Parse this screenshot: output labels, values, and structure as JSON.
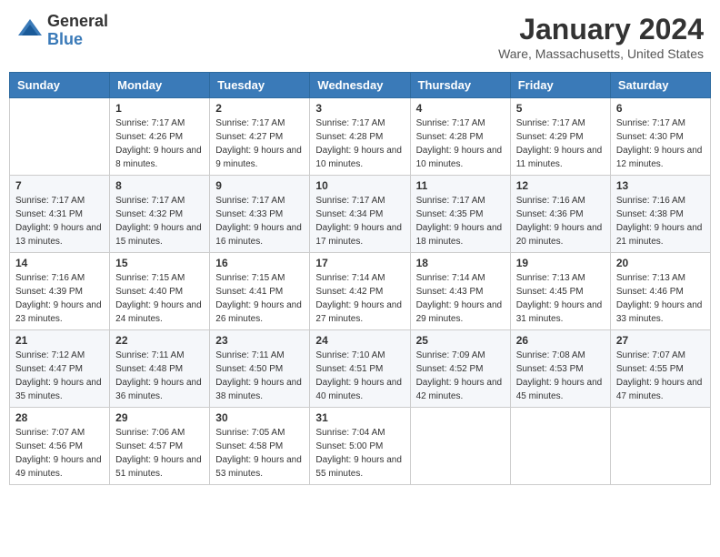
{
  "header": {
    "logo_general": "General",
    "logo_blue": "Blue",
    "title": "January 2024",
    "location": "Ware, Massachusetts, United States"
  },
  "days_of_week": [
    "Sunday",
    "Monday",
    "Tuesday",
    "Wednesday",
    "Thursday",
    "Friday",
    "Saturday"
  ],
  "weeks": [
    [
      {
        "day": "",
        "sunrise": "",
        "sunset": "",
        "daylight": ""
      },
      {
        "day": "1",
        "sunrise": "Sunrise: 7:17 AM",
        "sunset": "Sunset: 4:26 PM",
        "daylight": "Daylight: 9 hours and 8 minutes."
      },
      {
        "day": "2",
        "sunrise": "Sunrise: 7:17 AM",
        "sunset": "Sunset: 4:27 PM",
        "daylight": "Daylight: 9 hours and 9 minutes."
      },
      {
        "day": "3",
        "sunrise": "Sunrise: 7:17 AM",
        "sunset": "Sunset: 4:28 PM",
        "daylight": "Daylight: 9 hours and 10 minutes."
      },
      {
        "day": "4",
        "sunrise": "Sunrise: 7:17 AM",
        "sunset": "Sunset: 4:28 PM",
        "daylight": "Daylight: 9 hours and 10 minutes."
      },
      {
        "day": "5",
        "sunrise": "Sunrise: 7:17 AM",
        "sunset": "Sunset: 4:29 PM",
        "daylight": "Daylight: 9 hours and 11 minutes."
      },
      {
        "day": "6",
        "sunrise": "Sunrise: 7:17 AM",
        "sunset": "Sunset: 4:30 PM",
        "daylight": "Daylight: 9 hours and 12 minutes."
      }
    ],
    [
      {
        "day": "7",
        "sunrise": "Sunrise: 7:17 AM",
        "sunset": "Sunset: 4:31 PM",
        "daylight": "Daylight: 9 hours and 13 minutes."
      },
      {
        "day": "8",
        "sunrise": "Sunrise: 7:17 AM",
        "sunset": "Sunset: 4:32 PM",
        "daylight": "Daylight: 9 hours and 15 minutes."
      },
      {
        "day": "9",
        "sunrise": "Sunrise: 7:17 AM",
        "sunset": "Sunset: 4:33 PM",
        "daylight": "Daylight: 9 hours and 16 minutes."
      },
      {
        "day": "10",
        "sunrise": "Sunrise: 7:17 AM",
        "sunset": "Sunset: 4:34 PM",
        "daylight": "Daylight: 9 hours and 17 minutes."
      },
      {
        "day": "11",
        "sunrise": "Sunrise: 7:17 AM",
        "sunset": "Sunset: 4:35 PM",
        "daylight": "Daylight: 9 hours and 18 minutes."
      },
      {
        "day": "12",
        "sunrise": "Sunrise: 7:16 AM",
        "sunset": "Sunset: 4:36 PM",
        "daylight": "Daylight: 9 hours and 20 minutes."
      },
      {
        "day": "13",
        "sunrise": "Sunrise: 7:16 AM",
        "sunset": "Sunset: 4:38 PM",
        "daylight": "Daylight: 9 hours and 21 minutes."
      }
    ],
    [
      {
        "day": "14",
        "sunrise": "Sunrise: 7:16 AM",
        "sunset": "Sunset: 4:39 PM",
        "daylight": "Daylight: 9 hours and 23 minutes."
      },
      {
        "day": "15",
        "sunrise": "Sunrise: 7:15 AM",
        "sunset": "Sunset: 4:40 PM",
        "daylight": "Daylight: 9 hours and 24 minutes."
      },
      {
        "day": "16",
        "sunrise": "Sunrise: 7:15 AM",
        "sunset": "Sunset: 4:41 PM",
        "daylight": "Daylight: 9 hours and 26 minutes."
      },
      {
        "day": "17",
        "sunrise": "Sunrise: 7:14 AM",
        "sunset": "Sunset: 4:42 PM",
        "daylight": "Daylight: 9 hours and 27 minutes."
      },
      {
        "day": "18",
        "sunrise": "Sunrise: 7:14 AM",
        "sunset": "Sunset: 4:43 PM",
        "daylight": "Daylight: 9 hours and 29 minutes."
      },
      {
        "day": "19",
        "sunrise": "Sunrise: 7:13 AM",
        "sunset": "Sunset: 4:45 PM",
        "daylight": "Daylight: 9 hours and 31 minutes."
      },
      {
        "day": "20",
        "sunrise": "Sunrise: 7:13 AM",
        "sunset": "Sunset: 4:46 PM",
        "daylight": "Daylight: 9 hours and 33 minutes."
      }
    ],
    [
      {
        "day": "21",
        "sunrise": "Sunrise: 7:12 AM",
        "sunset": "Sunset: 4:47 PM",
        "daylight": "Daylight: 9 hours and 35 minutes."
      },
      {
        "day": "22",
        "sunrise": "Sunrise: 7:11 AM",
        "sunset": "Sunset: 4:48 PM",
        "daylight": "Daylight: 9 hours and 36 minutes."
      },
      {
        "day": "23",
        "sunrise": "Sunrise: 7:11 AM",
        "sunset": "Sunset: 4:50 PM",
        "daylight": "Daylight: 9 hours and 38 minutes."
      },
      {
        "day": "24",
        "sunrise": "Sunrise: 7:10 AM",
        "sunset": "Sunset: 4:51 PM",
        "daylight": "Daylight: 9 hours and 40 minutes."
      },
      {
        "day": "25",
        "sunrise": "Sunrise: 7:09 AM",
        "sunset": "Sunset: 4:52 PM",
        "daylight": "Daylight: 9 hours and 42 minutes."
      },
      {
        "day": "26",
        "sunrise": "Sunrise: 7:08 AM",
        "sunset": "Sunset: 4:53 PM",
        "daylight": "Daylight: 9 hours and 45 minutes."
      },
      {
        "day": "27",
        "sunrise": "Sunrise: 7:07 AM",
        "sunset": "Sunset: 4:55 PM",
        "daylight": "Daylight: 9 hours and 47 minutes."
      }
    ],
    [
      {
        "day": "28",
        "sunrise": "Sunrise: 7:07 AM",
        "sunset": "Sunset: 4:56 PM",
        "daylight": "Daylight: 9 hours and 49 minutes."
      },
      {
        "day": "29",
        "sunrise": "Sunrise: 7:06 AM",
        "sunset": "Sunset: 4:57 PM",
        "daylight": "Daylight: 9 hours and 51 minutes."
      },
      {
        "day": "30",
        "sunrise": "Sunrise: 7:05 AM",
        "sunset": "Sunset: 4:58 PM",
        "daylight": "Daylight: 9 hours and 53 minutes."
      },
      {
        "day": "31",
        "sunrise": "Sunrise: 7:04 AM",
        "sunset": "Sunset: 5:00 PM",
        "daylight": "Daylight: 9 hours and 55 minutes."
      },
      {
        "day": "",
        "sunrise": "",
        "sunset": "",
        "daylight": ""
      },
      {
        "day": "",
        "sunrise": "",
        "sunset": "",
        "daylight": ""
      },
      {
        "day": "",
        "sunrise": "",
        "sunset": "",
        "daylight": ""
      }
    ]
  ]
}
